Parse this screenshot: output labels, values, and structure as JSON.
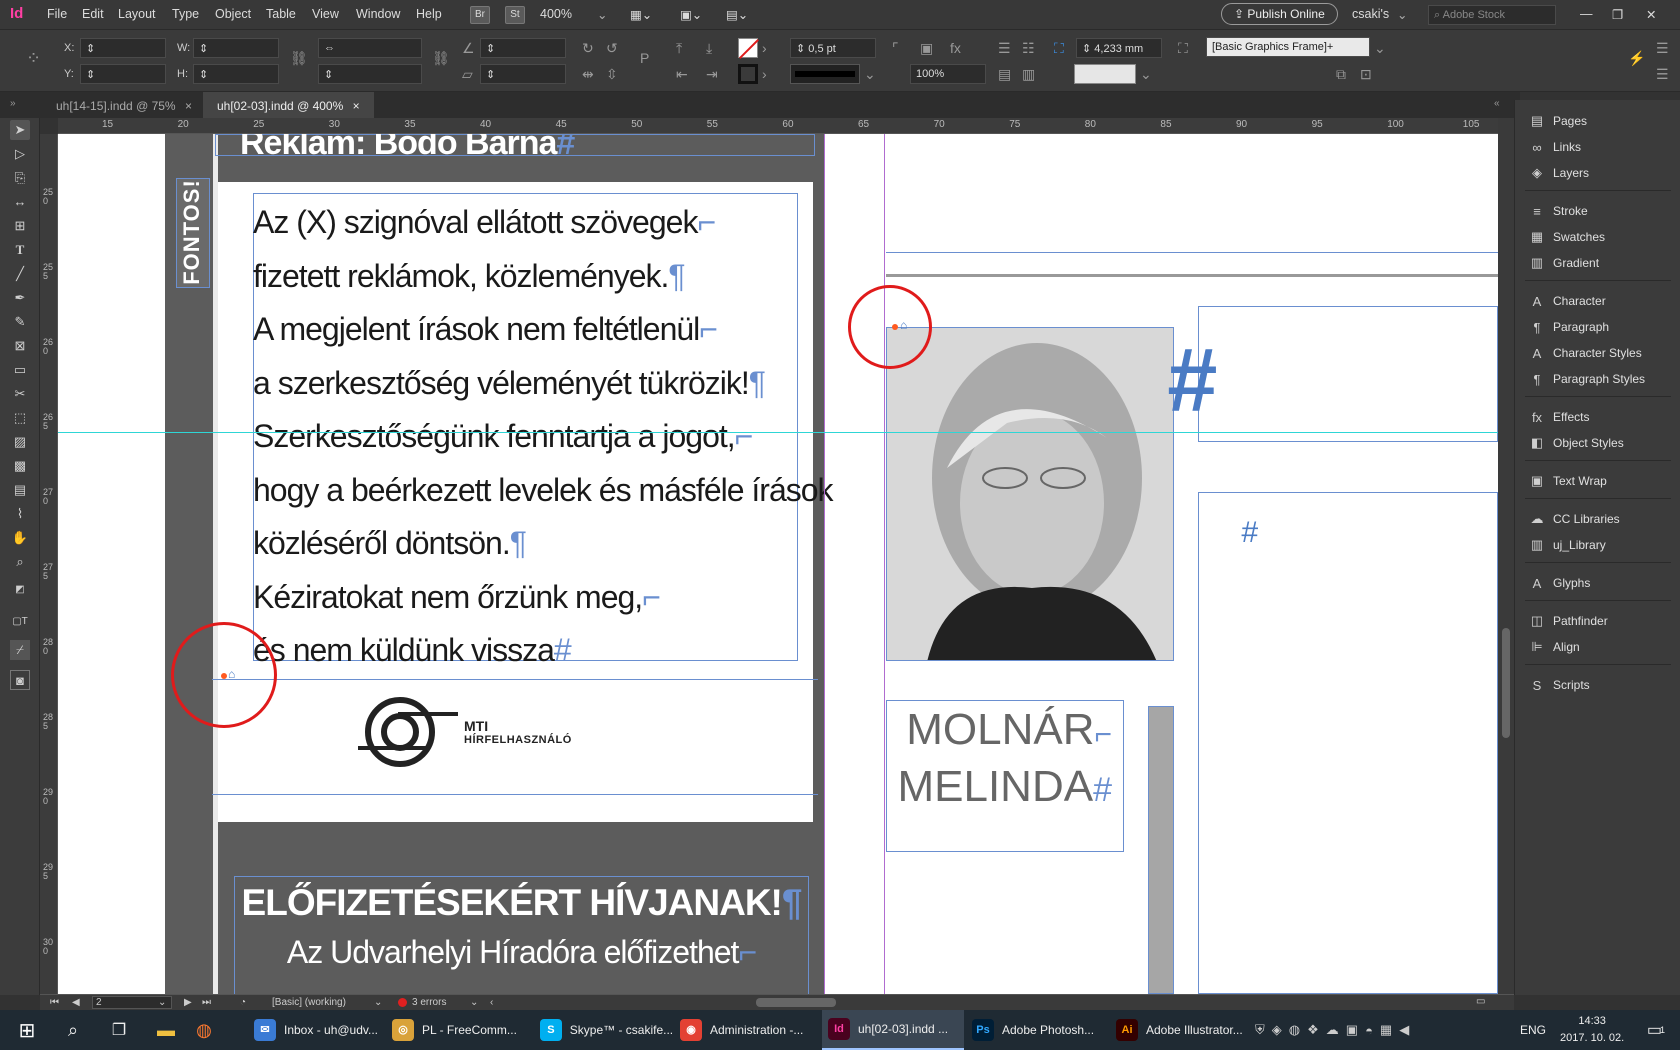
{
  "app": {
    "logo": "Id"
  },
  "menu": [
    "File",
    "Edit",
    "Layout",
    "Type",
    "Object",
    "Table",
    "View",
    "Window",
    "Help"
  ],
  "menu_chips": {
    "br": "Br",
    "st": "St"
  },
  "zoom": "400%",
  "publish_button": "Publish Online",
  "user": "csaki's",
  "search_placeholder": "Adobe Stock",
  "control": {
    "x_label": "X:",
    "y_label": "Y:",
    "w_label": "W:",
    "h_label": "H:",
    "stroke_weight": "0,5 pt",
    "opacity": "100%",
    "fitting_value": "4,233 mm",
    "object_style": "[Basic Graphics Frame]+"
  },
  "tabs": [
    {
      "label": "uh[14-15].indd @ 75%",
      "close": "×"
    },
    {
      "label": "uh[02-03].indd @ 400%",
      "close": "×"
    }
  ],
  "ruler_top": [
    "15",
    "20",
    "25",
    "30",
    "35",
    "40",
    "45",
    "50",
    "55",
    "60",
    "65",
    "70",
    "75",
    "80",
    "85",
    "90",
    "95",
    "100",
    "105"
  ],
  "ruler_left": [
    "250",
    "255",
    "260",
    "265",
    "270",
    "275",
    "280",
    "285",
    "290",
    "295",
    "300",
    "305"
  ],
  "page": {
    "headline_top": "Reklám: Bodó Barna",
    "vertical_label": "FONTOS!",
    "notice_lines": [
      "Az (X) szignóval ellátott szövegek",
      "fizetett reklámok, közlemények.",
      "A megjelent írások nem feltétlenül",
      "a szerkesztőség véleményét tükrözik!",
      "Szerkesztőségünk fenntartja a jogot,",
      "hogy a beérkezett levelek és másféle írások",
      "közléséről döntsön.",
      "Kéziratokat  nem őrzünk meg,",
      "és nem küldünk vissza"
    ],
    "logo_line1": "MTI",
    "logo_line2": "HÍRFELHASZNÁLÓ",
    "subscribe_title": "ELŐFIZETÉSEKÉRT  HÍVJANAK!",
    "subscribe_sub": "Az Udvarhelyi Híradóra előfizethet",
    "name_line1": "MOLNÁR",
    "name_line2": "MELINDA",
    "hash_big": "#",
    "hash_small": "#"
  },
  "panels": [
    {
      "label": "Pages",
      "icon": "pages-icon",
      "glyph": "▤"
    },
    {
      "label": "Links",
      "icon": "links-icon",
      "glyph": "∞"
    },
    {
      "label": "Layers",
      "icon": "layers-icon",
      "glyph": "◈"
    },
    {
      "label": "Stroke",
      "icon": "stroke-icon",
      "glyph": "≡"
    },
    {
      "label": "Swatches",
      "icon": "swatches-icon",
      "glyph": "▦"
    },
    {
      "label": "Gradient",
      "icon": "gradient-icon",
      "glyph": "▥"
    },
    {
      "label": "Character",
      "icon": "character-icon",
      "glyph": "A"
    },
    {
      "label": "Paragraph",
      "icon": "paragraph-icon",
      "glyph": "¶"
    },
    {
      "label": "Character Styles",
      "icon": "character-styles-icon",
      "glyph": "A"
    },
    {
      "label": "Paragraph Styles",
      "icon": "paragraph-styles-icon",
      "glyph": "¶"
    },
    {
      "label": "Effects",
      "icon": "effects-icon",
      "glyph": "fx"
    },
    {
      "label": "Object Styles",
      "icon": "object-styles-icon",
      "glyph": "◧"
    },
    {
      "label": "Text Wrap",
      "icon": "text-wrap-icon",
      "glyph": "▣"
    },
    {
      "label": "CC Libraries",
      "icon": "cc-libraries-icon",
      "glyph": "☁"
    },
    {
      "label": "uj_Library",
      "icon": "library-icon",
      "glyph": "▥"
    },
    {
      "label": "Glyphs",
      "icon": "glyphs-icon",
      "glyph": "A"
    },
    {
      "label": "Pathfinder",
      "icon": "pathfinder-icon",
      "glyph": "◫"
    },
    {
      "label": "Align",
      "icon": "align-icon",
      "glyph": "⊫"
    },
    {
      "label": "Scripts",
      "icon": "scripts-icon",
      "glyph": "S"
    }
  ],
  "status": {
    "page_number": "2",
    "profile": "[Basic] (working)",
    "errors": "3 errors"
  },
  "taskbar": {
    "apps": [
      {
        "label": "Inbox - uh@udv...",
        "short": "✉",
        "color": "#3a7bd5"
      },
      {
        "label": "PL - FreeComm...",
        "short": "◎",
        "color": "#d9a23a"
      },
      {
        "label": "Skype™ - csakife...",
        "short": "S",
        "color": "#00aff0"
      },
      {
        "label": "Administration -...",
        "short": "◉",
        "color": "#e34133"
      },
      {
        "label": "uh[02-03].indd ...",
        "short": "Id",
        "color": "#49021f"
      },
      {
        "label": "Adobe Photosh...",
        "short": "Ps",
        "color": "#001e36"
      },
      {
        "label": "Adobe Illustrator...",
        "short": "Ai",
        "color": "#330000"
      }
    ],
    "lang": "ENG",
    "time": "14:33",
    "date": "2017. 10. 02.",
    "notif_count": "1"
  }
}
